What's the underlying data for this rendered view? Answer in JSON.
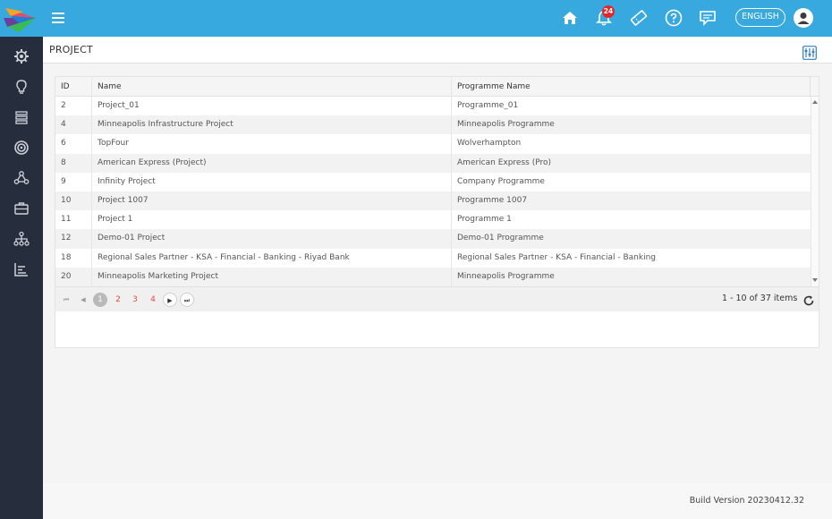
{
  "header": {
    "notification_count": "24",
    "language": "ENGLISH",
    "icons": [
      "home-icon",
      "bell-icon",
      "ticket-icon",
      "help-icon",
      "chat-icon",
      "user-avatar-icon"
    ]
  },
  "sidebar": {
    "items": [
      "gear-icon",
      "lightbulb-icon",
      "layers-icon",
      "target-icon",
      "network-icon",
      "briefcase-icon",
      "org-chart-icon",
      "report-icon"
    ]
  },
  "page": {
    "title": "PROJECT"
  },
  "grid": {
    "columns": [
      "ID",
      "Name",
      "Programme Name"
    ],
    "rows": [
      {
        "id": "2",
        "name": "Project_01",
        "programme": "Programme_01"
      },
      {
        "id": "4",
        "name": "Minneapolis Infrastructure Project",
        "programme": "Minneapolis Programme"
      },
      {
        "id": "6",
        "name": "TopFour",
        "programme": "Wolverhampton"
      },
      {
        "id": "8",
        "name": "American Express (Project)",
        "programme": "American Express (Pro)"
      },
      {
        "id": "9",
        "name": "Infinity Project",
        "programme": "Company Programme"
      },
      {
        "id": "10",
        "name": "Project 1007",
        "programme": "Programme 1007"
      },
      {
        "id": "11",
        "name": "Project 1",
        "programme": "Programme 1"
      },
      {
        "id": "12",
        "name": "Demo-01 Project",
        "programme": "Demo-01 Programme"
      },
      {
        "id": "18",
        "name": "Regional Sales Partner - KSA - Financial - Banking - Riyad Bank",
        "programme": "Regional Sales Partner - KSA - Financial - Banking"
      },
      {
        "id": "20",
        "name": "Minneapolis Marketing Project",
        "programme": "Minneapolis Programme"
      }
    ]
  },
  "pager": {
    "pages": [
      "1",
      "2",
      "3",
      "4"
    ],
    "current_page": "1",
    "info": "1 - 10 of 37 items"
  },
  "footer": {
    "build": "Build Version 20230412.32"
  },
  "colors": {
    "topbar": "#38a9df",
    "sidebar": "#262d3d",
    "page_link": "#e74c3c",
    "badge": "#e5252a"
  }
}
